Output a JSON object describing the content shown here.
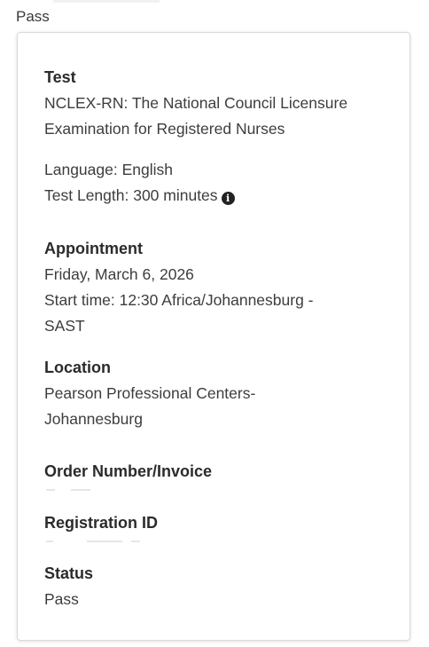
{
  "header": {
    "status_label": "Pass"
  },
  "card": {
    "test": {
      "heading": "Test",
      "name_line1": "NCLEX-RN: The National Council Licensure",
      "name_line2": "Examination for Registered Nurses",
      "language": "Language:  English",
      "length": "Test Length: 300 minutes",
      "info_icon": "info-icon"
    },
    "appointment": {
      "heading": "Appointment",
      "date": "Friday, March 6, 2026",
      "start_line1": "Start time: 12:30 Africa/Johannesburg -",
      "start_line2": "SAST"
    },
    "location": {
      "heading": "Location",
      "line1": "Pearson Professional Centers-",
      "line2": "Johannesburg"
    },
    "order": {
      "heading": "Order Number/Invoice"
    },
    "registration": {
      "heading": "Registration ID"
    },
    "status": {
      "heading": "Status",
      "value": "Pass"
    }
  }
}
